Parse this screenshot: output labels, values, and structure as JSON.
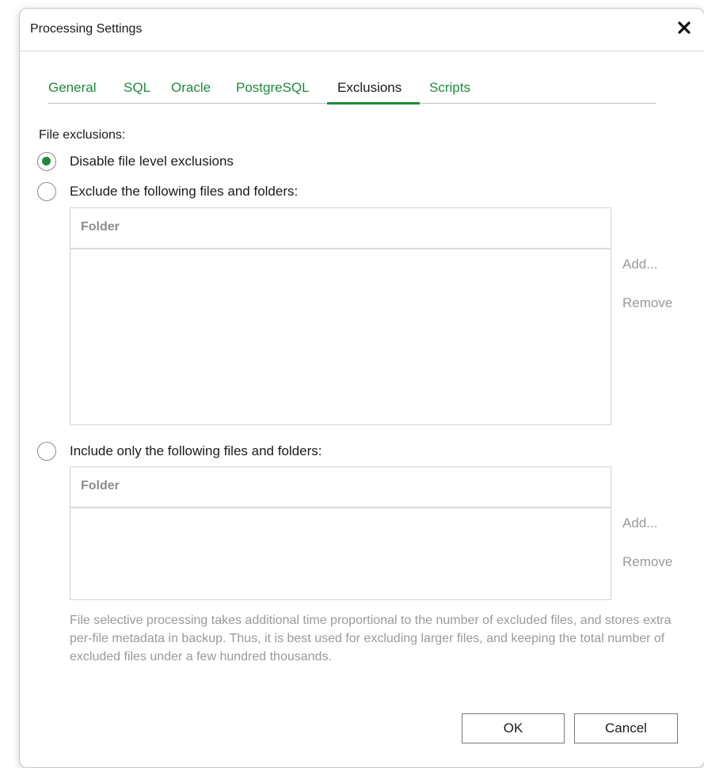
{
  "dialog": {
    "title": "Processing Settings",
    "close_icon": "close-icon"
  },
  "tabs": [
    {
      "label": "General",
      "active": false
    },
    {
      "label": "SQL",
      "active": false
    },
    {
      "label": "Oracle",
      "active": false
    },
    {
      "label": "PostgreSQL",
      "active": false
    },
    {
      "label": "Exclusions",
      "active": true
    },
    {
      "label": "Scripts",
      "active": false
    }
  ],
  "exclusions": {
    "section_label": "File exclusions:",
    "options": [
      {
        "label": "Disable file level exclusions",
        "checked": true
      },
      {
        "label": "Exclude the following files and folders:",
        "checked": false
      },
      {
        "label": "Include only the following files and folders:",
        "checked": false
      }
    ],
    "exclude_list": {
      "column_header": "Folder",
      "rows": [],
      "add_label": "Add...",
      "remove_label": "Remove"
    },
    "include_list": {
      "column_header": "Folder",
      "rows": [],
      "add_label": "Add...",
      "remove_label": "Remove"
    },
    "note": "File selective processing takes additional time proportional to the number of excluded files, and stores extra per-file metadata in backup. Thus, it is best used for excluding larger files, and keeping the total number of excluded files under a few hundred thousands."
  },
  "footer": {
    "ok_label": "OK",
    "cancel_label": "Cancel"
  },
  "colors": {
    "accent": "#1f8a3a",
    "disabled_text": "#9a9a9a"
  }
}
